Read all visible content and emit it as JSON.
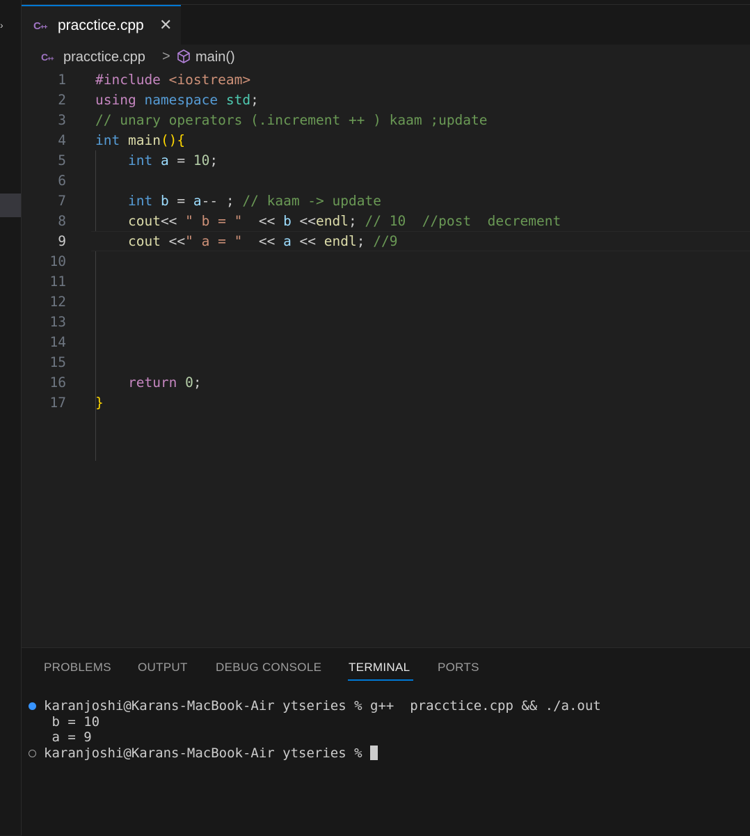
{
  "tab": {
    "filename": "pracctice.cpp",
    "icon": "cpp-file-icon",
    "close": "✕"
  },
  "breadcrumb": {
    "file": "pracctice.cpp",
    "separator": ">",
    "symbol": "main()",
    "symbol_icon": "cube-icon"
  },
  "editor": {
    "active_line": 9,
    "line_numbers": [
      "1",
      "2",
      "3",
      "4",
      "5",
      "6",
      "7",
      "8",
      "9",
      "10",
      "11",
      "12",
      "13",
      "14",
      "15",
      "16",
      "17"
    ],
    "lines": [
      [
        {
          "t": "#include ",
          "c": "pp"
        },
        {
          "t": "<iostream>",
          "c": "inc"
        }
      ],
      [
        {
          "t": "using ",
          "c": "ctl"
        },
        {
          "t": "namespace ",
          "c": "kw"
        },
        {
          "t": "std",
          "c": "ns"
        },
        {
          "t": ";",
          "c": ""
        }
      ],
      [
        {
          "t": "// unary operators (.increment ++ ) kaam ;update",
          "c": "cm"
        }
      ],
      [
        {
          "t": "int ",
          "c": "kw"
        },
        {
          "t": "main",
          "c": "fn"
        },
        {
          "t": "(){",
          "c": "br"
        }
      ],
      [
        {
          "t": "    ",
          "c": ""
        },
        {
          "t": "int ",
          "c": "kw"
        },
        {
          "t": "a",
          "c": "var"
        },
        {
          "t": " = ",
          "c": ""
        },
        {
          "t": "10",
          "c": "num"
        },
        {
          "t": ";",
          "c": ""
        }
      ],
      [],
      [
        {
          "t": "    ",
          "c": ""
        },
        {
          "t": "int ",
          "c": "kw"
        },
        {
          "t": "b",
          "c": "var"
        },
        {
          "t": " = ",
          "c": ""
        },
        {
          "t": "a",
          "c": "var"
        },
        {
          "t": "-- ; ",
          "c": ""
        },
        {
          "t": "// kaam -> update",
          "c": "cm"
        }
      ],
      [
        {
          "t": "    ",
          "c": ""
        },
        {
          "t": "cout",
          "c": "fn"
        },
        {
          "t": "<< ",
          "c": ""
        },
        {
          "t": "\" b = \"",
          "c": "str"
        },
        {
          "t": "  << ",
          "c": ""
        },
        {
          "t": "b",
          "c": "var"
        },
        {
          "t": " <<",
          "c": ""
        },
        {
          "t": "endl",
          "c": "fn"
        },
        {
          "t": "; ",
          "c": ""
        },
        {
          "t": "// 10  //post  decrement",
          "c": "cm"
        }
      ],
      [
        {
          "t": "    ",
          "c": ""
        },
        {
          "t": "cout",
          "c": "fn"
        },
        {
          "t": " <<",
          "c": ""
        },
        {
          "t": "\" a = \"",
          "c": "str"
        },
        {
          "t": "  << ",
          "c": ""
        },
        {
          "t": "a",
          "c": "var"
        },
        {
          "t": " << ",
          "c": ""
        },
        {
          "t": "endl",
          "c": "fn"
        },
        {
          "t": "; ",
          "c": ""
        },
        {
          "t": "//9",
          "c": "cm"
        }
      ],
      [],
      [],
      [],
      [],
      [],
      [],
      [
        {
          "t": "    ",
          "c": ""
        },
        {
          "t": "return ",
          "c": "ctl"
        },
        {
          "t": "0",
          "c": "num"
        },
        {
          "t": ";",
          "c": ""
        }
      ],
      [
        {
          "t": "}",
          "c": "br"
        }
      ]
    ]
  },
  "panel": {
    "tabs": [
      "PROBLEMS",
      "OUTPUT",
      "DEBUG CONSOLE",
      "TERMINAL",
      "PORTS"
    ],
    "active_tab": "TERMINAL"
  },
  "terminal": {
    "prompt": "karanjoshi@Karans-MacBook-Air ytseries % ",
    "command": "g++  pracctice.cpp && ./a.out",
    "output": [
      " b = 10",
      " a = 9"
    ]
  }
}
